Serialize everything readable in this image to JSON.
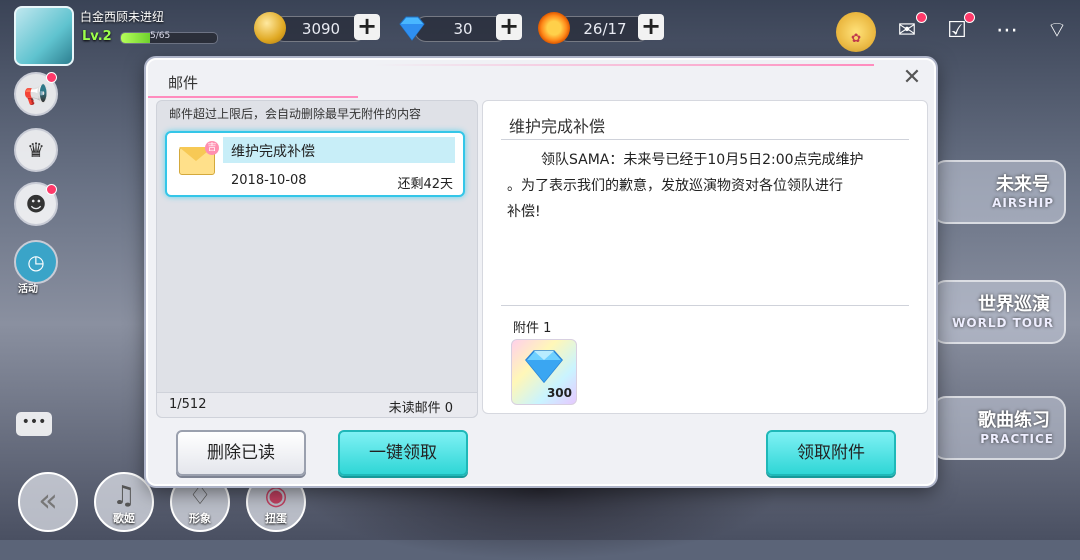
{
  "player": {
    "name": "白金西顾未进纽",
    "level": "Lv.2",
    "xp_text": "5/65",
    "xp_fraction": 0.3
  },
  "resources": [
    {
      "icon": "gold-coin-icon",
      "value": "3090"
    },
    {
      "icon": "diamond-icon",
      "value": "30"
    },
    {
      "icon": "sun-energy-icon",
      "value": "26/17"
    }
  ],
  "top_icons": [
    "event-badge-icon",
    "mail-icon",
    "checkin-icon",
    "more-icon",
    "wifi-icon"
  ],
  "side_icons": [
    "megaphone-icon",
    "trophy-icon",
    "friend-icon",
    "clock-icon"
  ],
  "side_clock_label": "活动",
  "right_cards": [
    {
      "cn": "未来号",
      "en": "AIRSHIP"
    },
    {
      "cn": "世界巡演",
      "en": "WORLD TOUR"
    },
    {
      "cn": "歌曲练习",
      "en": "PRACTICE"
    }
  ],
  "bottom_nav": [
    {
      "icon": "back-icon",
      "label": ""
    },
    {
      "icon": "music-note-icon",
      "label": "歌姬"
    },
    {
      "icon": "wardrobe-icon",
      "label": "形象"
    },
    {
      "icon": "gacha-icon",
      "label": "扭蛋"
    }
  ],
  "mail": {
    "title": "邮件",
    "list_note": "邮件超过上限后，会自动删除最早无附件的内容",
    "items": [
      {
        "subject": "维护完成补偿",
        "date": "2018-10-08",
        "remaining": "还剩42天",
        "badge": "吉"
      }
    ],
    "pager": "1/512",
    "unread": "未读邮件 0",
    "detail": {
      "title": "维护完成补偿",
      "body_line1": "领队SAMA：未来号已经于10月5日2:00点完成维护",
      "body_line2": "。为了表示我们的歉意，发放巡演物资对各位领队进行",
      "body_line3": "补偿!",
      "attachment_label": "附件 1",
      "attachment_qty": "300",
      "attachment_icon": "diamond-icon"
    },
    "buttons": {
      "delete_read": "删除已读",
      "claim_all": "一键领取",
      "claim_attachment": "领取附件"
    }
  },
  "colors": {
    "accent_cyan": "#34c6e8",
    "accent_pink": "#ff8cbe",
    "button_cyan": "#2fd6d6"
  }
}
